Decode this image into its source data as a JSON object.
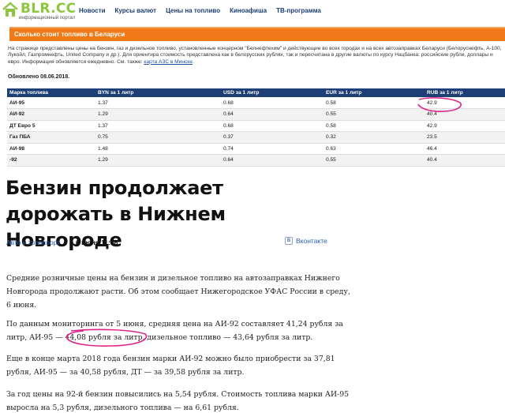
{
  "header": {
    "logo_text": "BLR.CC",
    "logo_subtitle": "информационный портал",
    "nav": [
      "Новости",
      "Курсы валют",
      "Цены на топливо",
      "Киноафиша",
      "ТВ-программа"
    ]
  },
  "banner": {
    "title": "Сколько стоит топливо в Беларуси"
  },
  "intro": {
    "text": "На странице представлены цены на бензин, газ и дизельное топливо, установленные концерном \"Белнефтехим\" и действующие во всех городах и на всех автозаправках Беларуси (Белоруснефть, А-100, Лукойл, Газпромнефть, United Company и др.). Для ориентира стоимость представлена как в белорусских рублях, так и пересчитана в другие валюты по курсу Нацбанка: российские рубли, доллары и евро. Информация обновляется ежедневно.",
    "see_also": "См. также: ",
    "map_link": "карта АЗС в Минске",
    "see_also_end": "."
  },
  "updated": "Обновлено 08.06.2018.",
  "table": {
    "headers": [
      "Марка топлива",
      "BYN за 1 литр",
      "USD за 1 литр",
      "EUR за 1 литр",
      "RUB за 1 литр"
    ],
    "rows": [
      [
        "АИ-95",
        "1.37",
        "0.68",
        "0.58",
        "42.9"
      ],
      [
        "АИ-92",
        "1.29",
        "0.64",
        "0.55",
        "40.4"
      ],
      [
        "ДТ Евро 5",
        "1.37",
        "0.68",
        "0.58",
        "42.9"
      ],
      [
        "Газ ПБА",
        "0.75",
        "0.37",
        "0.32",
        "23.5"
      ],
      [
        "АИ-98",
        "1.48",
        "0.74",
        "0.63",
        "46.4"
      ],
      [
        "-92",
        "1.29",
        "0.64",
        "0.55",
        "40.4"
      ]
    ]
  },
  "article": {
    "headline": "Бензин продолжает дорожать в Нижнем Новгороде",
    "category": "Авто и транспорт",
    "date": "6 июня 11:16",
    "share_label": "Вконтакте",
    "p1": "Средние розничные цены на бензин и дизельное топливо на автозаправках Нижнего Новгорода продолжают расти. Об этом сообщает Нижегородское УФАС России в среду, 6 июня.",
    "p2": "По данным мониторинга от 5 июня, средняя цена на АИ-92 составляет 41,24 рубля за литр, АИ-95 — 44,08 рубля за литр, дизельное топливо — 43,64 рубля за литр.",
    "p3": "Еще в конце марта 2018 года бензин марки АИ-92 можно было приобрести за 37,81 рубля, АИ-95 — за 40,58 рубля, ДТ — за 39,58 рубля за литр.",
    "p4": "За год цены на 92-й бензин повысились на 5,54 рубля. Стоимость топлива марки АИ-95 выросла на 5,3 рубля, дизельного топлива — на 6,61 рубля."
  },
  "colors": {
    "logo_green": "#8cc63f",
    "nav_blue": "#1a3e73",
    "banner_orange": "#f07a17",
    "table_header": "#1e3f75",
    "link_blue": "#2a5db0",
    "annotation_pink": "#e0248a"
  }
}
